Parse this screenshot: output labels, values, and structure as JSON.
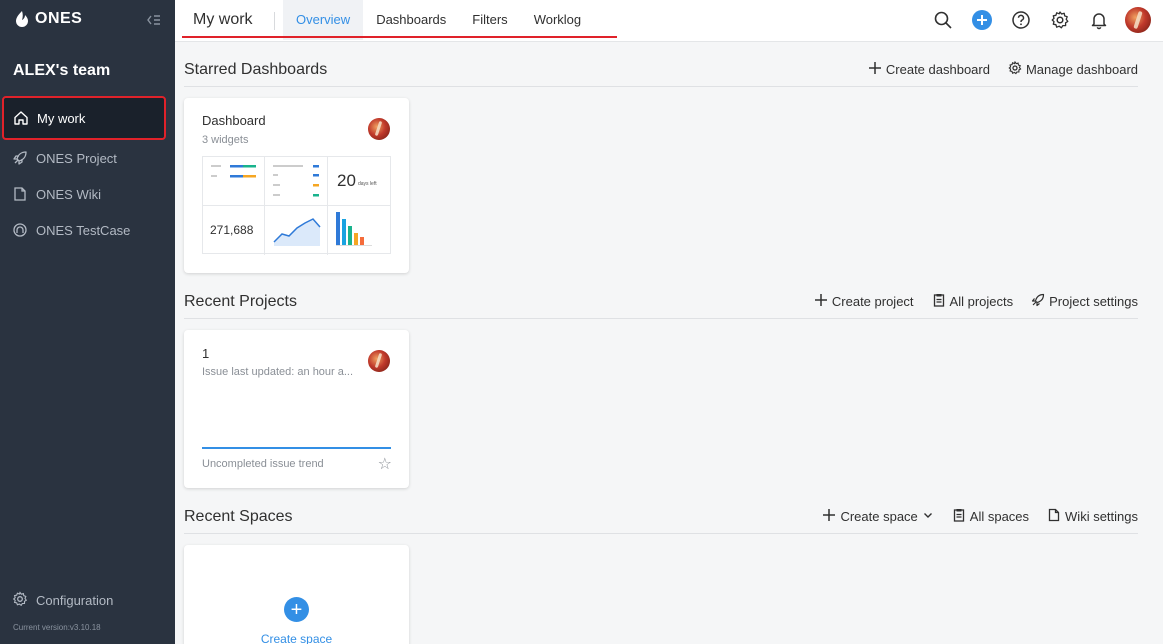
{
  "sidebar": {
    "logo": "ONES",
    "team": "ALEX's team",
    "items": [
      {
        "label": "My work",
        "icon": "home-icon"
      },
      {
        "label": "ONES Project",
        "icon": "rocket-icon"
      },
      {
        "label": "ONES Wiki",
        "icon": "document-icon"
      },
      {
        "label": "ONES TestCase",
        "icon": "testcase-icon"
      }
    ],
    "config_label": "Configuration",
    "version": "Current version:v3.10.18"
  },
  "topbar": {
    "title": "My work",
    "tabs": [
      "Overview",
      "Dashboards",
      "Filters",
      "Worklog"
    ],
    "active_tab": "Overview",
    "icons": [
      "search-icon",
      "add-icon",
      "help-icon",
      "settings-icon",
      "bell-icon",
      "avatar"
    ]
  },
  "starred": {
    "title": "Starred Dashboards",
    "actions": [
      "Create dashboard",
      "Manage dashboard"
    ],
    "card": {
      "name": "Dashboard",
      "subtitle": "3 widgets",
      "widget_count_value": "20",
      "widget_note": "days left",
      "widget_number": "271,688"
    }
  },
  "projects": {
    "title": "Recent Projects",
    "actions": [
      "Create project",
      "All projects",
      "Project settings"
    ],
    "card": {
      "name": "1",
      "subtitle": "Issue last updated: an hour a...",
      "trend_label": "Uncompleted issue trend"
    }
  },
  "spaces": {
    "title": "Recent Spaces",
    "actions": [
      "Create space",
      "All spaces",
      "Wiki settings"
    ],
    "create_label": "Create space"
  },
  "colors": {
    "sidebar_bg": "#2a3340",
    "accent": "#338fe5",
    "highlight_box": "#e0222a"
  }
}
